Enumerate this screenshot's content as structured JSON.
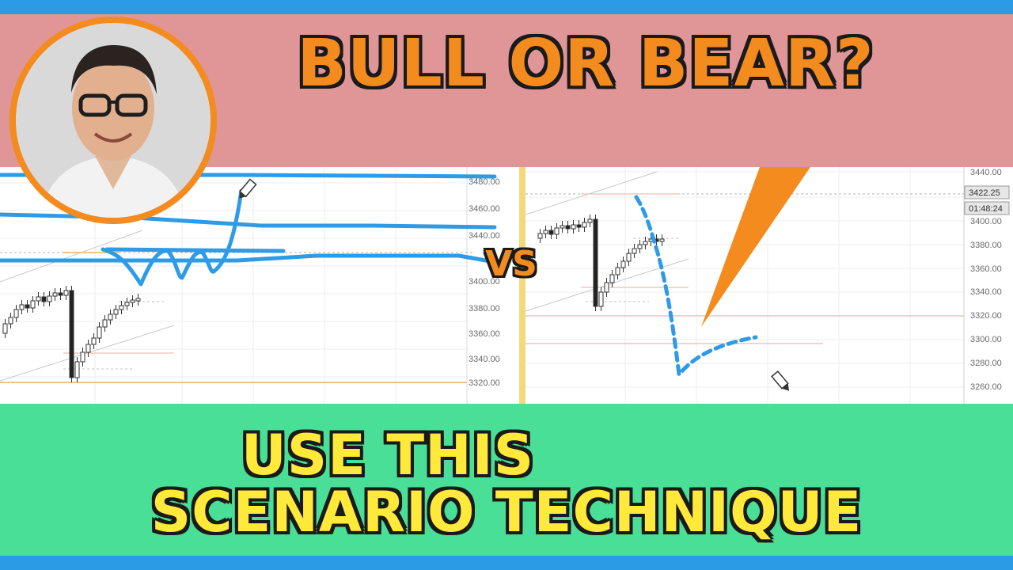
{
  "headline": "BULL OR BEAR?",
  "vs_label": "VS",
  "subline": [
    "USE THIS",
    "SCENARIO TECHNIQUE"
  ],
  "colors": {
    "frame": "#2b9be6",
    "top_banner": "#e09597",
    "bottom_banner": "#49df96",
    "headline_text": "#f38b1f",
    "subline_text": "#ffe93a",
    "scenario_line": "#2f9be6"
  },
  "left_chart": {
    "price_ticks": [
      "3480.00",
      "3460.00",
      "3440.00",
      "3400.00",
      "3380.00",
      "3360.00",
      "3340.00",
      "3320.00"
    ]
  },
  "right_chart": {
    "price_ticks": [
      "3440.00",
      "3400.00",
      "3380.00",
      "3360.00",
      "3340.00",
      "3320.00",
      "3300.00",
      "3280.00",
      "3260.00"
    ],
    "current_price": "3422.25",
    "countdown": "01:48:24"
  },
  "icons": [
    "presenter-photo",
    "pencil-cursor-icon",
    "orange-arrow-icon"
  ]
}
